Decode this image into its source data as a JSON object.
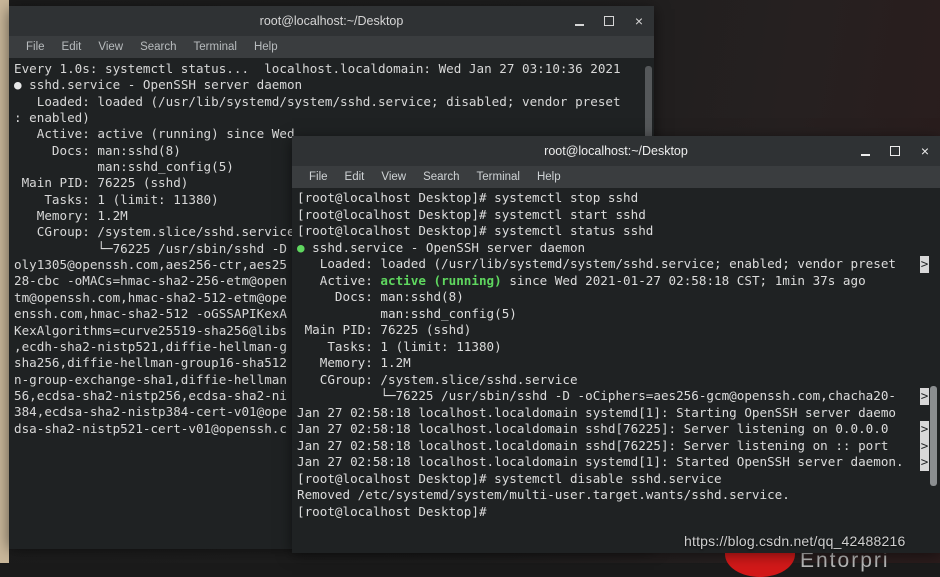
{
  "desktop": {
    "logo_text": "Entorpri",
    "watermark": "https://blog.csdn.net/qq_42488216"
  },
  "window_buttons": {
    "minimize": "_",
    "maximize": "□",
    "close": "×"
  },
  "menu": {
    "file": "File",
    "edit": "Edit",
    "view": "View",
    "search": "Search",
    "terminal": "Terminal",
    "help": "Help"
  },
  "back_window": {
    "title": "root@localhost:~/Desktop",
    "lines": [
      "Every 1.0s: systemctl status...  localhost.localdomain: Wed Jan 27 03:10:36 2021",
      "",
      "● sshd.service - OpenSSH server daemon",
      "   Loaded: loaded (/usr/lib/systemd/system/sshd.service; disabled; vendor preset",
      ": enabled)",
      "   Active: active (running) since Wed",
      "     Docs: man:sshd(8)",
      "           man:sshd_config(5)",
      " Main PID: 76225 (sshd)",
      "    Tasks: 1 (limit: 11380)",
      "   Memory: 1.2M",
      "   CGroup: /system.slice/sshd.service",
      "           └─76225 /usr/sbin/sshd -D",
      "oly1305@openssh.com,aes256-ctr,aes25",
      "28-cbc -oMACs=hmac-sha2-256-etm@open",
      "tm@openssh.com,hmac-sha2-512-etm@ope",
      "enssh.com,hmac-sha2-512 -oGSSAPIKexA",
      "KexAlgorithms=curve25519-sha256@libs",
      ",ecdh-sha2-nistp521,diffie-hellman-g",
      "sha256,diffie-hellman-group16-sha512",
      "n-group-exchange-sha1,diffie-hellman",
      "56,ecdsa-sha2-nistp256,ecdsa-sha2-ni",
      "384,ecdsa-sha2-nistp384-cert-v01@ope",
      "dsa-sha2-nistp521-cert-v01@openssh.c"
    ]
  },
  "front_window": {
    "title": "root@localhost:~/Desktop",
    "prompt": "[root@localhost Desktop]#",
    "lines": [
      {
        "text": "[root@localhost Desktop]# systemctl stop sshd",
        "style": "normal",
        "trunc": false
      },
      {
        "text": "[root@localhost Desktop]# systemctl start sshd",
        "style": "normal",
        "trunc": false
      },
      {
        "text": "[root@localhost Desktop]# systemctl status sshd",
        "style": "normal",
        "trunc": false
      },
      {
        "text": "● sshd.service - OpenSSH server daemon",
        "style": "greendot",
        "trunc": false
      },
      {
        "text": "   Loaded: loaded (/usr/lib/systemd/system/sshd.service; enabled; vendor preset",
        "style": "normal",
        "trunc": true
      },
      {
        "text": "   Active: active (running) since Wed 2021-01-27 02:58:18 CST; 1min 37s ago",
        "style": "active",
        "trunc": false
      },
      {
        "text": "     Docs: man:sshd(8)",
        "style": "normal",
        "trunc": false
      },
      {
        "text": "           man:sshd_config(5)",
        "style": "normal",
        "trunc": false
      },
      {
        "text": " Main PID: 76225 (sshd)",
        "style": "normal",
        "trunc": false
      },
      {
        "text": "    Tasks: 1 (limit: 11380)",
        "style": "normal",
        "trunc": false
      },
      {
        "text": "   Memory: 1.2M",
        "style": "normal",
        "trunc": false
      },
      {
        "text": "   CGroup: /system.slice/sshd.service",
        "style": "normal",
        "trunc": false
      },
      {
        "text": "           └─76225 /usr/sbin/sshd -D -oCiphers=aes256-gcm@openssh.com,chacha20-",
        "style": "normal",
        "trunc": true
      },
      {
        "text": "",
        "style": "normal",
        "trunc": false
      },
      {
        "text": "Jan 27 02:58:18 localhost.localdomain systemd[1]: Starting OpenSSH server daemo",
        "style": "normal",
        "trunc": true
      },
      {
        "text": "Jan 27 02:58:18 localhost.localdomain sshd[76225]: Server listening on 0.0.0.0 ",
        "style": "normal",
        "trunc": true
      },
      {
        "text": "Jan 27 02:58:18 localhost.localdomain sshd[76225]: Server listening on :: port ",
        "style": "normal",
        "trunc": true
      },
      {
        "text": "Jan 27 02:58:18 localhost.localdomain systemd[1]: Started OpenSSH server daemon.",
        "style": "normal",
        "trunc": false
      },
      {
        "text": "",
        "style": "normal",
        "trunc": false
      },
      {
        "text": "[root@localhost Desktop]# systemctl disable sshd.service",
        "style": "normal",
        "trunc": false
      },
      {
        "text": "Removed /etc/systemd/system/multi-user.target.wants/sshd.service.",
        "style": "normal",
        "trunc": false
      },
      {
        "text": "[root@localhost Desktop]#",
        "style": "normal",
        "trunc": false
      }
    ],
    "active_parts": {
      "label": "   Active: ",
      "highlight": "active (running)",
      "rest": " since Wed 2021-01-27 02:58:18 CST; 1min 37s ago"
    },
    "trunc_marker": ">"
  }
}
